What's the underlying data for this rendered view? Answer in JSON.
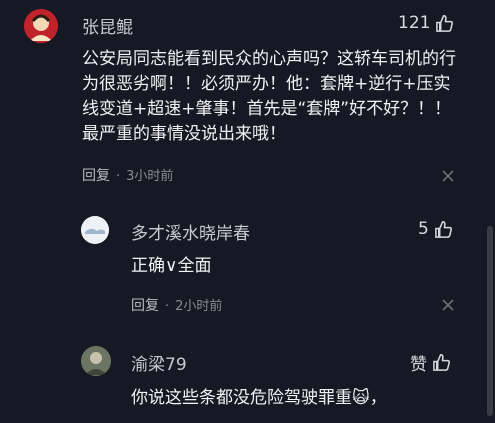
{
  "comments": [
    {
      "user": "张昆鲲",
      "likes": "121",
      "text": "公安局同志能看到民众的心声吗？这轿车司机的行为很恶劣啊！！必须严办！他：套牌+逆行+压实线变道+超速+肇事！首先是“套牌”好不好？！！最严重的事情没说出来哦！",
      "reply_label": "回复",
      "time": "3小时前"
    },
    {
      "user": "多才溪水晓岸春",
      "likes": "5",
      "text": "正确∨全面",
      "reply_label": "回复",
      "time": "2小时前"
    },
    {
      "user": "渝梁79",
      "likes": "赞",
      "text": "你说这些条都没危险驾驶罪重🙀，"
    }
  ],
  "colors": {
    "background": "#161823",
    "accent_red": "#e02e2e"
  }
}
